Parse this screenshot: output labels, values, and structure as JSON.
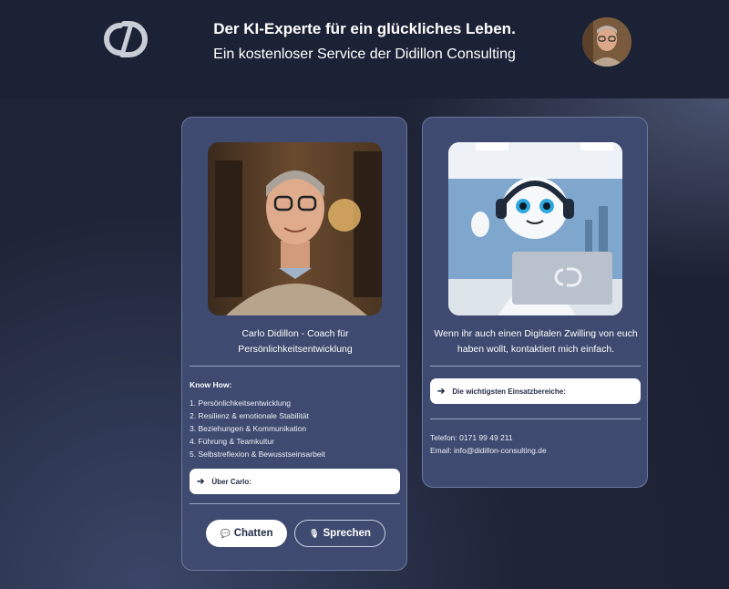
{
  "header": {
    "title": "Der KI-Experte für ein glückliches Leben.",
    "subtitle": "Ein kostenloser Service der Didillon Consulting",
    "logo_icon": "cd-monogram-logo",
    "avatar_icon": "profile-avatar"
  },
  "left_card": {
    "caption_line1": "Carlo Didillon - Coach für",
    "caption_line2": "Persönlichkeitsentwicklung",
    "knowhow_title": "Know How:",
    "knowhow_items": [
      "1. Persönlichkeitsentwicklung",
      "2. Resilienz & emotionale Stabilität",
      "3. Beziehungen & Kommunikation",
      "4. Führung & Teamkultur",
      "5. Selbstreflexion & Bewusstseinsarbeit"
    ],
    "about_button": "Über Carlo:",
    "chat_button": "Chatten",
    "speak_button": "Sprechen"
  },
  "right_card": {
    "caption_line1": "Wenn ihr auch einen Digitalen Zwilling von euch",
    "caption_line2": "haben wollt, kontaktiert mich einfach.",
    "areas_button": "Die wichtigsten Einsatzbereiche:",
    "phone": "Telefon: 0171 99 49 211",
    "email": "Email: info@didillon-consulting.de"
  },
  "colors": {
    "card_bg": "#3e4a6f",
    "page_bg": "#1f2538",
    "accent_text": "#1f2a44"
  }
}
